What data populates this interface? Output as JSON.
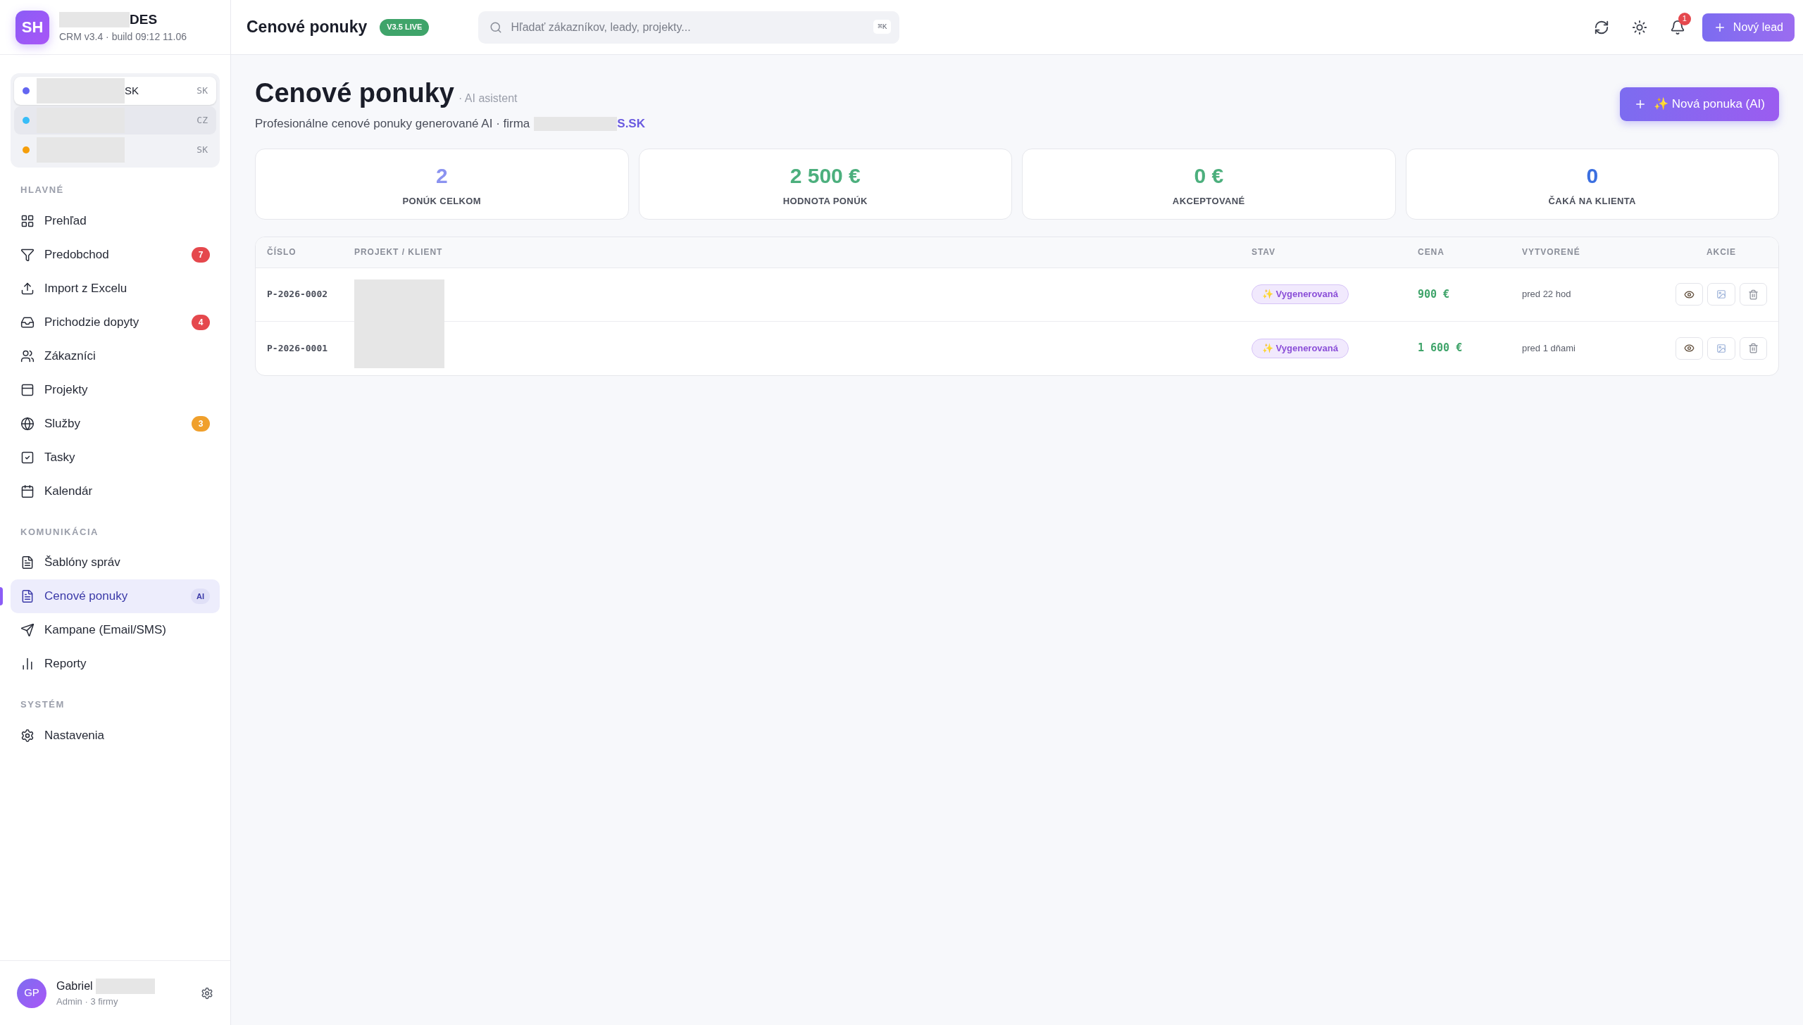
{
  "brand": {
    "initials": "SH",
    "name_visible": "DES",
    "subtitle": "CRM v3.4 · build 09:12 11.06"
  },
  "companies": [
    {
      "name_visible": "SK",
      "code": "SK",
      "color": "#6366f1",
      "selected": true
    },
    {
      "code": "CZ",
      "color": "#38bdf8",
      "selected": false
    },
    {
      "code": "SK",
      "color": "#f59e0b",
      "selected": false
    }
  ],
  "nav_sections": [
    {
      "title": "HLAVNÉ",
      "items": [
        {
          "label": "Prehľad",
          "selected": false
        },
        {
          "label": "Predobchod",
          "selected": false,
          "badge": {
            "text": "7",
            "color": "#e5484d"
          }
        },
        {
          "label": "Import z Excelu",
          "selected": false
        },
        {
          "label": "Prichodzie dopyty",
          "selected": false,
          "badge": {
            "text": "4",
            "color": "#e5484d"
          }
        },
        {
          "label": "Zákazníci",
          "selected": false
        },
        {
          "label": "Projekty",
          "selected": false
        },
        {
          "label": "Služby",
          "selected": false,
          "badge": {
            "text": "3",
            "color": "#f0a02c"
          }
        },
        {
          "label": "Tasky",
          "selected": false
        },
        {
          "label": "Kalendár",
          "selected": false
        }
      ]
    },
    {
      "title": "KOMUNIKÁCIA",
      "items": [
        {
          "label": "Šablóny správ",
          "selected": false
        },
        {
          "label": "Cenové ponuky",
          "selected": true,
          "tag": "AI"
        },
        {
          "label": "Kampane (Email/SMS)",
          "selected": false
        },
        {
          "label": "Reporty",
          "selected": false
        }
      ]
    },
    {
      "title": "SYSTÉM",
      "items": [
        {
          "label": "Nastavenia",
          "selected": false
        }
      ]
    }
  ],
  "user": {
    "initials": "GP",
    "name_visible": "Gabriel",
    "role": "Admin · 3 firmy"
  },
  "topbar": {
    "title": "Cenové ponuky",
    "version_badge": "V3.5 LIVE",
    "search": {
      "placeholder": "Hľadať zákazníkov, leady, projekty...",
      "shortcut": "⌘K"
    },
    "notifications": "1",
    "new_lead": "Nový lead"
  },
  "page": {
    "title": "Cenové ponuky",
    "title_note": "· AI asistent",
    "description": "Profesionálne cenové ponuky generované AI · firma",
    "firm_visible": "S.SK",
    "new_quote": "✨ Nová ponuka (AI)"
  },
  "stats": [
    {
      "value": "2",
      "label": "PONÚK CELKOM",
      "color": "#8b93f0"
    },
    {
      "value": "2 500 €",
      "label": "HODNOTA PONÚK",
      "color": "#4caf7d"
    },
    {
      "value": "0 €",
      "label": "AKCEPTOVANÉ",
      "color": "#4caf7d"
    },
    {
      "value": "0",
      "label": "ČAKÁ NA KLIENTA",
      "color": "#3b6fe0"
    }
  ],
  "table": {
    "columns": [
      "ČÍSLO",
      "PROJEKT / KLIENT",
      "STAV",
      "CENA",
      "VYTVORENÉ",
      "AKCIE"
    ],
    "rows": [
      {
        "number": "P-2026-0002",
        "status": "✨ Vygenerovaná",
        "price": "900 €",
        "created": "pred 22 hod"
      },
      {
        "number": "P-2026-0001",
        "status": "✨ Vygenerovaná",
        "price": "1 600 €",
        "created": "pred 1 dňami"
      }
    ]
  }
}
